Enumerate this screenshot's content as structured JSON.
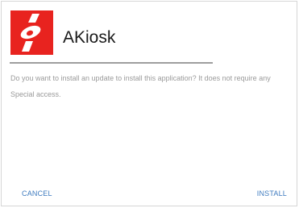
{
  "dialog": {
    "app_icon": "akiosk-logo-icon",
    "app_name": "AKiosk",
    "message": "Do you want to install an update to install this application? It does not require any Special access.",
    "cancel_label": "CANCEL",
    "install_label": "INSTALL"
  },
  "colors": {
    "icon_background": "#e8231f",
    "button_text": "#3e7bbf",
    "message_text": "#9a9a9a"
  }
}
